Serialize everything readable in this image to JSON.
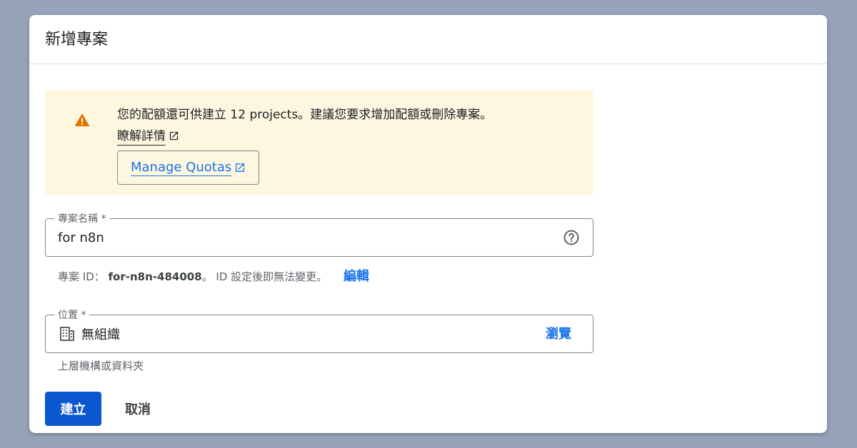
{
  "dialog": {
    "title": "新增專案"
  },
  "alert": {
    "message": "您的配額還可供建立 12 projects。建議您要求增加配額或刪除專案。",
    "learn_more": "瞭解詳情",
    "manage_quotas": "Manage Quotas",
    "accent_color": "#e37400",
    "background_color": "#fef7e0"
  },
  "project_name": {
    "label": "專案名稱 *",
    "value": "for n8n",
    "help_icon": "help-circle-icon"
  },
  "project_id": {
    "prefix": "專案 ID：",
    "value": "for-n8n-484008",
    "suffix": "。 ID 設定後即無法變更。",
    "edit_label": "編輯"
  },
  "location": {
    "label": "位置 *",
    "icon": "building-icon",
    "value": "無組織",
    "browse_label": "瀏覽",
    "helper": "上層機構或資料夾"
  },
  "actions": {
    "create_label": "建立",
    "cancel_label": "取消",
    "primary_color": "#0b57d0",
    "link_color": "#1a73e8"
  }
}
